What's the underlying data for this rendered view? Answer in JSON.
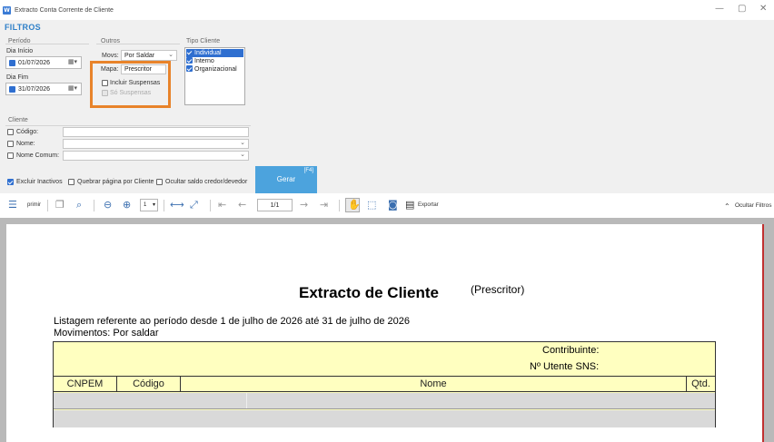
{
  "window": {
    "title": "Extracto Conta Corrente de Cliente",
    "icon_letter": "W",
    "controls": [
      "—",
      "▢",
      "✕"
    ]
  },
  "filters": {
    "title": "FILTROS",
    "periodo": {
      "label": "Período",
      "inicio_label": "Dia Início",
      "inicio_value": "01/07/2026",
      "fim_label": "Dia Fim",
      "fim_value": "31/07/2026"
    },
    "outros": {
      "label": "Outros",
      "movs_label": "Movs:",
      "movs_value": "Por Saldar",
      "mapa_label": "Mapa:",
      "mapa_value": "Prescritor",
      "incluir_suspensas": "Incluir Suspensas",
      "so_suspensas": "Só Suspensas"
    },
    "tipo_cliente": {
      "label": "Tipo Cliente",
      "items": [
        "Individual",
        "Interno",
        "Organizacional"
      ]
    },
    "cliente": {
      "label": "Cliente",
      "codigo": "Código:",
      "nome": "Nome:",
      "nome_comum": "Nome Comum:"
    },
    "options": {
      "excluir_inactivos": "Excluir Inactivos",
      "quebrar_pagina": "Quebrar página por Cliente",
      "ocultar_saldo": "Ocultar saldo credor/devedor"
    },
    "gerar": {
      "label": "Gerar",
      "shortcut": "[F4]"
    }
  },
  "toolbar": {
    "imprimir": "primir",
    "zoom_value": "1",
    "page_value": "1/1",
    "exportar": "Exportar",
    "ocultar_filtros": "Ocultar Filtros"
  },
  "report": {
    "title": "Extracto de Cliente",
    "subtitle": "(Prescritor)",
    "period_line": "Listagem referente ao período desde 1 de julho de 2026 até 31 de julho de 2026",
    "movs_line": "Movimentos: Por saldar",
    "contribuinte": "Contribuinte:",
    "utente": "Nº Utente SNS:",
    "columns": [
      "CNPEM",
      "Código",
      "Nome",
      "Qtd."
    ]
  }
}
